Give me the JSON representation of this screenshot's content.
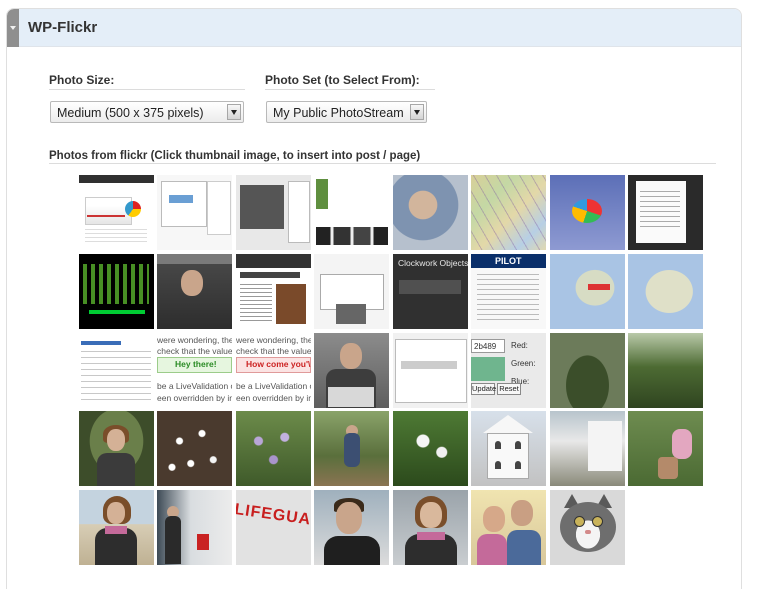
{
  "widget": {
    "title": "WP-Flickr"
  },
  "photo_size": {
    "label": "Photo Size:",
    "selected": "Medium (500 x 375 pixels)"
  },
  "photo_set": {
    "label": "Photo Set (to Select From):",
    "selected": "My Public PhotoStream"
  },
  "photos": {
    "label": "Photos from flickr (Click thumbnail image, to insert into post / page)",
    "thumb_text": {
      "code_line_1": "were wondering, the ho",
      "code_line_2": "check that the value er",
      "code_line_3": "be a LiveValidation obj",
      "code_line_4": "een overridden by incluc",
      "code2_line_1": "were wondering, the ho",
      "code2_line_2": "check that the value en",
      "code2_line_3": "be a LiveValidation obje",
      "code2_line_4": "een overridden by incluc",
      "hey_there": "Hey there!",
      "how_come": "How come you'\\",
      "clockwork": "Clockwork Objects",
      "pilot": "PILOT",
      "lifeguard": "LIFEGUARD",
      "hex_value": "2b489",
      "red_label": "Red:",
      "green_label": "Green:",
      "blue_label": "Blue:",
      "update_label": "Update",
      "reset_label": "Reset"
    }
  }
}
